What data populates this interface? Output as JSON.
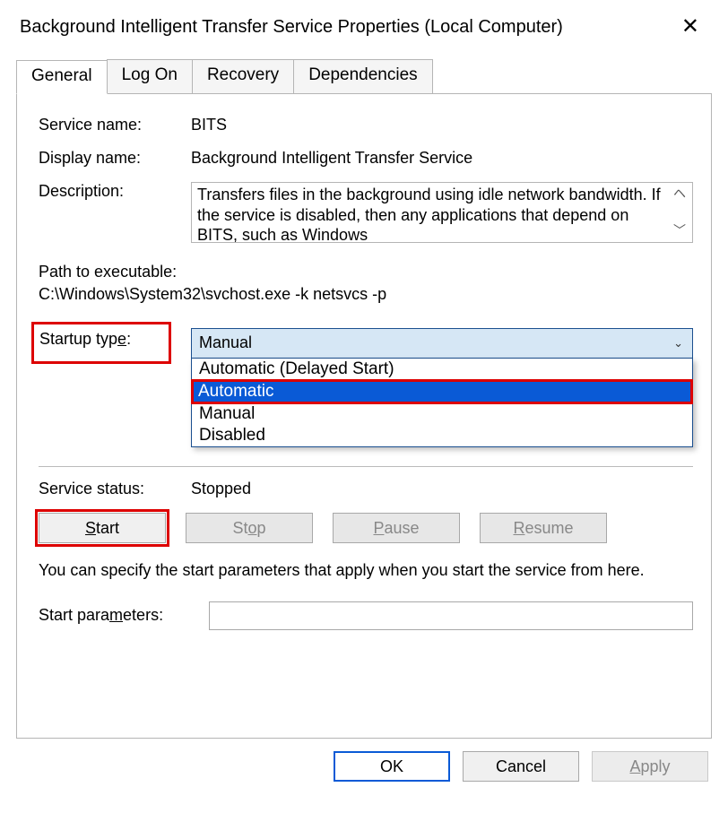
{
  "window": {
    "title": "Background Intelligent Transfer Service Properties (Local Computer)"
  },
  "tabs": {
    "general": "General",
    "logon": "Log On",
    "recovery": "Recovery",
    "dependencies": "Dependencies",
    "active": "general"
  },
  "fields": {
    "service_name_label": "Service name:",
    "service_name_value": "BITS",
    "display_name_label": "Display name:",
    "display_name_value": "Background Intelligent Transfer Service",
    "description_label": "Description:",
    "description_value": "Transfers files in the background using idle network bandwidth. If the service is disabled, then any applications that depend on BITS, such as Windows",
    "path_label": "Path to executable:",
    "path_value": "C:\\Windows\\System32\\svchost.exe -k netsvcs -p",
    "startup_type_label_pre": "Startup typ",
    "startup_type_label_u": "e",
    "startup_type_label_post": ":",
    "startup_type_value": "Manual",
    "startup_options": {
      "delayed": "Automatic (Delayed Start)",
      "automatic": "Automatic",
      "manual": "Manual",
      "disabled": "Disabled",
      "highlighted": "automatic"
    },
    "status_label": "Service status:",
    "status_value": "Stopped",
    "hint": "You can specify the start parameters that apply when you start the service from here.",
    "params_label_pre": "Start para",
    "params_label_u": "m",
    "params_label_post": "eters:",
    "params_value": ""
  },
  "buttons": {
    "start_u": "S",
    "start_post": "tart",
    "stop_pre": "St",
    "stop_u": "o",
    "stop_post": "p",
    "pause_u": "P",
    "pause_post": "ause",
    "resume_u": "R",
    "resume_post": "esume",
    "ok": "OK",
    "cancel": "Cancel",
    "apply_u": "A",
    "apply_post": "pply"
  }
}
